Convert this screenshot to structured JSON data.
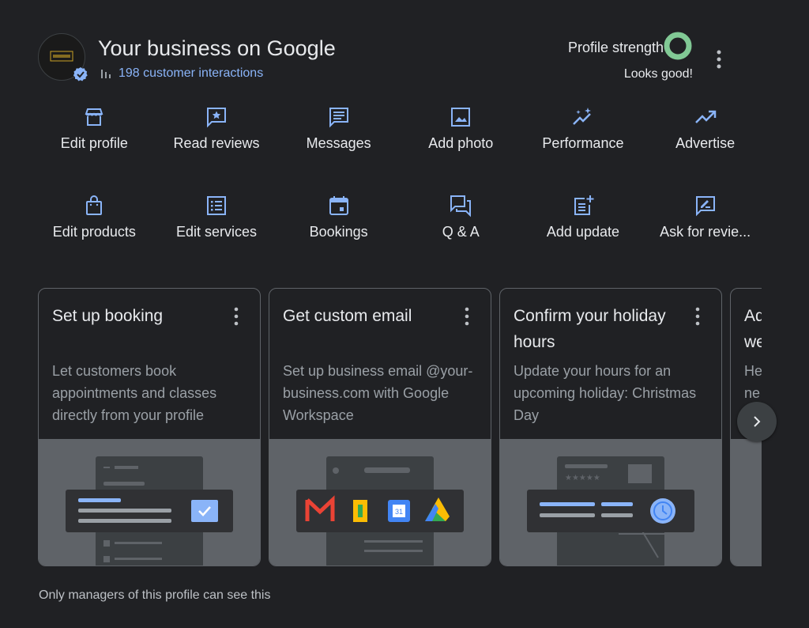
{
  "header": {
    "title": "Your business on Google",
    "interactions": "198 customer interactions",
    "profile_strength_label": "Profile strength",
    "profile_strength_status": "Looks good!",
    "logo_text": "DESIGN"
  },
  "actions": [
    {
      "label": "Edit profile",
      "icon": "storefront-icon"
    },
    {
      "label": "Read reviews",
      "icon": "review-star-icon"
    },
    {
      "label": "Messages",
      "icon": "message-icon"
    },
    {
      "label": "Add photo",
      "icon": "image-icon"
    },
    {
      "label": "Performance",
      "icon": "sparkle-chart-icon"
    },
    {
      "label": "Advertise",
      "icon": "trending-up-icon"
    },
    {
      "label": "Edit products",
      "icon": "shopping-bag-icon"
    },
    {
      "label": "Edit services",
      "icon": "list-icon"
    },
    {
      "label": "Bookings",
      "icon": "calendar-icon"
    },
    {
      "label": "Q & A",
      "icon": "forum-icon"
    },
    {
      "label": "Add update",
      "icon": "post-add-icon"
    },
    {
      "label": "Ask for revie...",
      "icon": "rate-review-icon"
    }
  ],
  "cards": [
    {
      "title": "Set up booking",
      "description": "Let customers book appointments and classes directly from your profile"
    },
    {
      "title": "Get custom email",
      "description": "Set up business email @your-business.com with Google Workspace"
    },
    {
      "title": "Confirm your holiday hours",
      "description": "Update your hours for an upcoming holiday: Christmas Day"
    },
    {
      "title": "Ad we",
      "description": "He ne"
    }
  ],
  "footer": "Only managers of this profile can see this",
  "colors": {
    "background": "#202124",
    "accent": "#8ab4f8",
    "strength": "#81c995",
    "card_border": "#5f6368"
  }
}
